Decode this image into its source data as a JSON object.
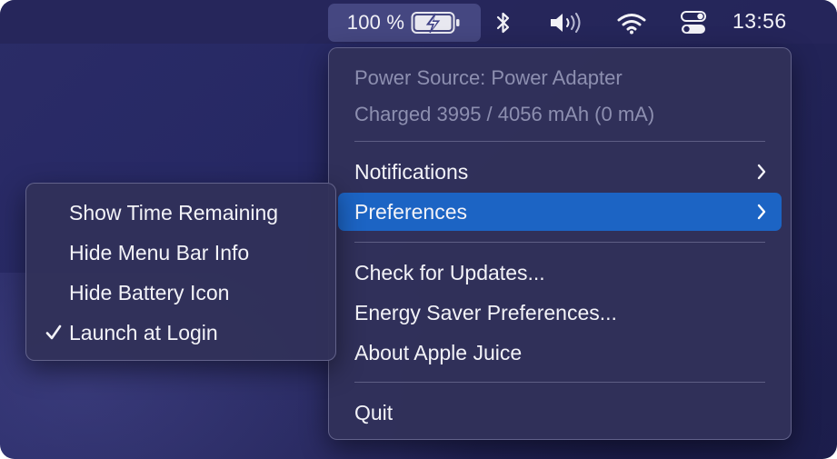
{
  "menubar": {
    "battery_percent": "100 %",
    "battery_level": 1.0,
    "clock": "13:56",
    "icons": [
      "battery-charging-icon",
      "bluetooth-icon",
      "volume-icon",
      "wifi-icon",
      "control-center-icon"
    ]
  },
  "main_menu": {
    "power_source": "Power Source: Power Adapter",
    "charge_info": "Charged 3995 / 4056 mAh (0 mA)",
    "items": [
      {
        "label": "Notifications",
        "has_submenu": true
      },
      {
        "label": "Preferences",
        "has_submenu": true,
        "selected": true
      },
      {
        "label": "Check for Updates..."
      },
      {
        "label": "Energy Saver Preferences..."
      },
      {
        "label": "About Apple Juice"
      },
      {
        "label": "Quit"
      }
    ]
  },
  "submenu": {
    "items": [
      {
        "label": "Show Time Remaining",
        "checked": false
      },
      {
        "label": "Hide Menu Bar Info",
        "checked": false
      },
      {
        "label": "Hide Battery Icon",
        "checked": false
      },
      {
        "label": "Launch at Login",
        "checked": true
      }
    ]
  },
  "colors": {
    "selection": "#1c64c4",
    "menubar": "#26265a",
    "menu_background": "#31315a",
    "disabled_text": "#8d8fb0"
  }
}
